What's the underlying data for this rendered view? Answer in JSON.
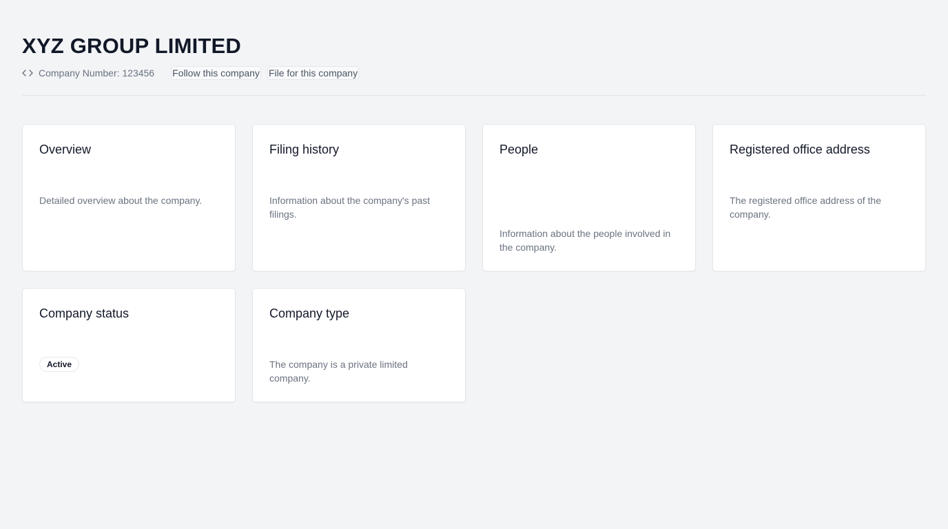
{
  "company": {
    "name": "XYZ GROUP LIMITED",
    "number_text": "Company Number: 123456",
    "follow_label": "Follow this company",
    "file_label": "File for this company",
    "code_icon": "code-icon"
  },
  "cards": [
    {
      "title": "Overview",
      "description": "Detailed overview about the company."
    },
    {
      "title": "Filing history",
      "description": "Information about the company's past filings."
    },
    {
      "title": "People",
      "description": "Information about the people involved in the company."
    },
    {
      "title": "Registered office address",
      "description": "The registered office address of the company."
    },
    {
      "title": "Company status",
      "status": "Active"
    },
    {
      "title": "Company type",
      "description": "The company is a private limited company."
    }
  ],
  "colors": {
    "background": "#f2f4f6",
    "card": "#ffffff",
    "text_primary": "#111827",
    "text_secondary": "#6b7280",
    "border": "#e5e7eb"
  }
}
